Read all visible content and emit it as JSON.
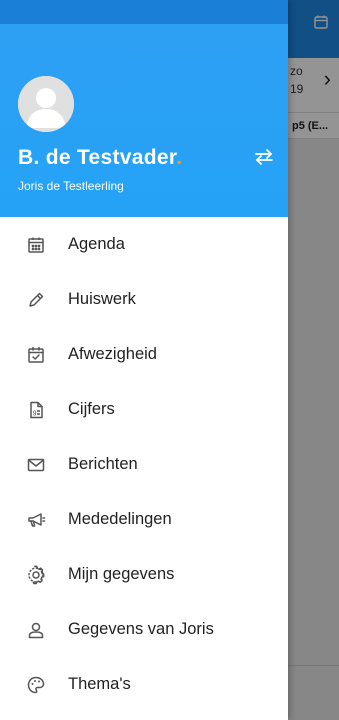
{
  "background": {
    "date_line1": "zo",
    "date_line2": "19",
    "item_text": "p5 (E..."
  },
  "header": {
    "user_name": "B. de Testvader",
    "user_dot": ".",
    "student_name": "Joris de Testleerling",
    "avatar_icon": "person-icon",
    "switch_icon": "swap-icon",
    "accent_color": "#2ea0f4"
  },
  "menu": {
    "items": [
      {
        "label": "Agenda",
        "icon": "calendar-icon"
      },
      {
        "label": "Huiswerk",
        "icon": "pencil-icon"
      },
      {
        "label": "Afwezigheid",
        "icon": "calendar-check-icon"
      },
      {
        "label": "Cijfers",
        "icon": "grade-file-icon"
      },
      {
        "label": "Berichten",
        "icon": "mail-icon"
      },
      {
        "label": "Mededelingen",
        "icon": "megaphone-icon"
      },
      {
        "label": "Mijn gegevens",
        "icon": "gear-icon"
      },
      {
        "label": "Gegevens van Joris",
        "icon": "user-icon"
      },
      {
        "label": "Thema's",
        "icon": "palette-icon"
      }
    ]
  }
}
